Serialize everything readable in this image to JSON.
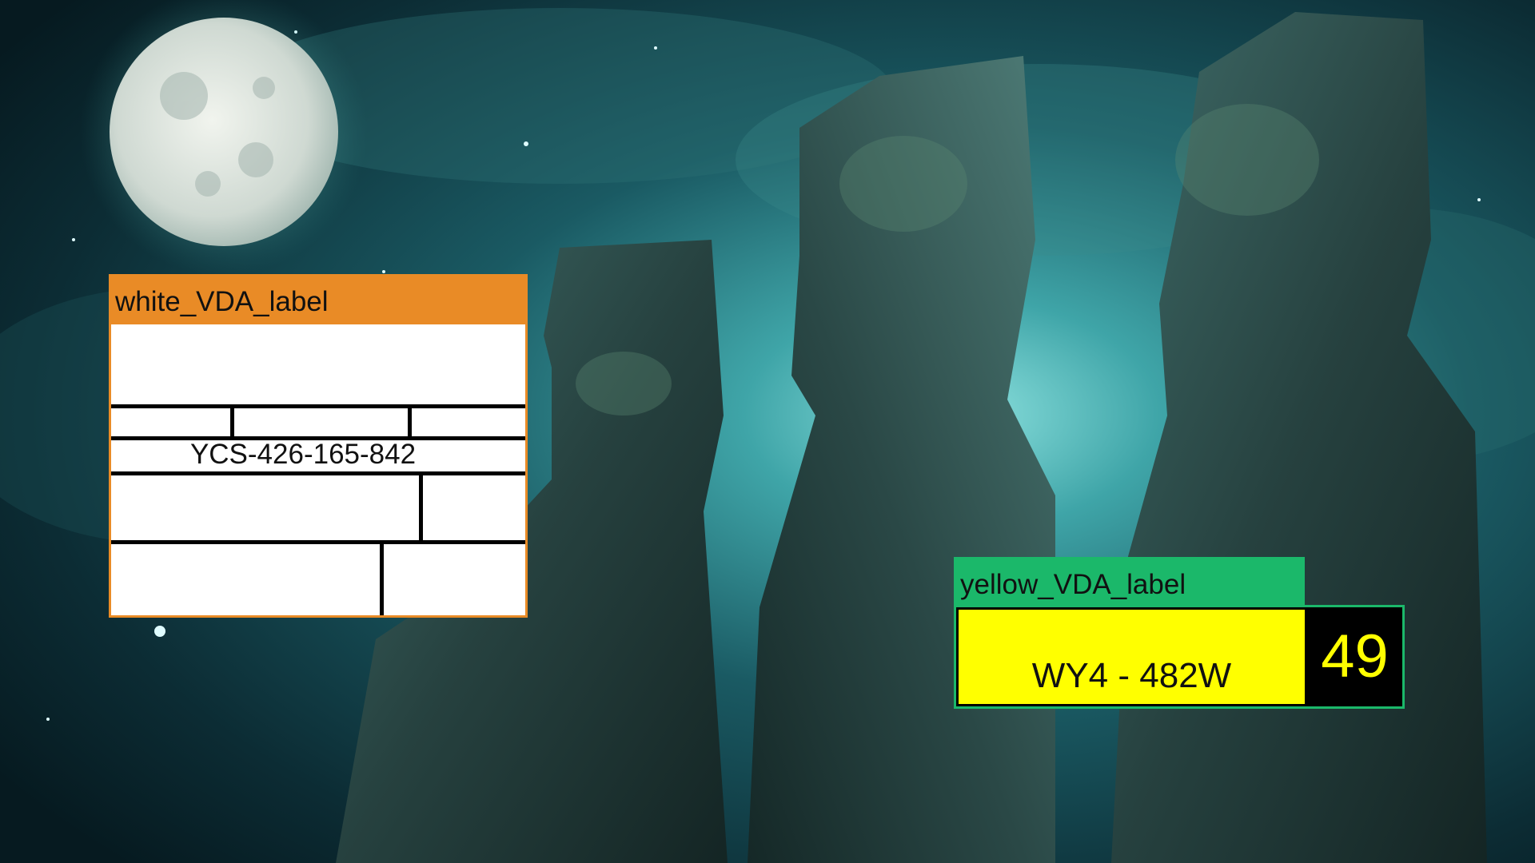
{
  "white_label": {
    "tag": "white_VDA_label",
    "code": "YCS-426-165-842",
    "tag_color": "#e98b26"
  },
  "yellow_label": {
    "tag": "yellow_VDA_label",
    "code": "WY4 - 482W",
    "number": "49",
    "tag_color": "#1bb86a",
    "plate_color": "#ffff00"
  }
}
